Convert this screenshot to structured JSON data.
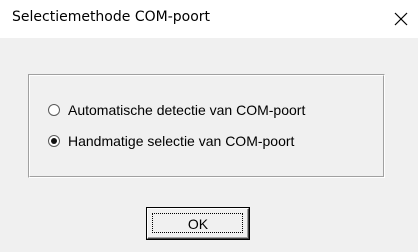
{
  "window": {
    "title": "Selectiemethode COM-poort",
    "close_icon": "close-icon"
  },
  "group": {
    "options": [
      {
        "label": "Automatische detectie van COM-poort",
        "selected": false
      },
      {
        "label": "Handmatige selectie van COM-poort",
        "selected": true
      }
    ]
  },
  "buttons": {
    "ok_label": "OK"
  }
}
